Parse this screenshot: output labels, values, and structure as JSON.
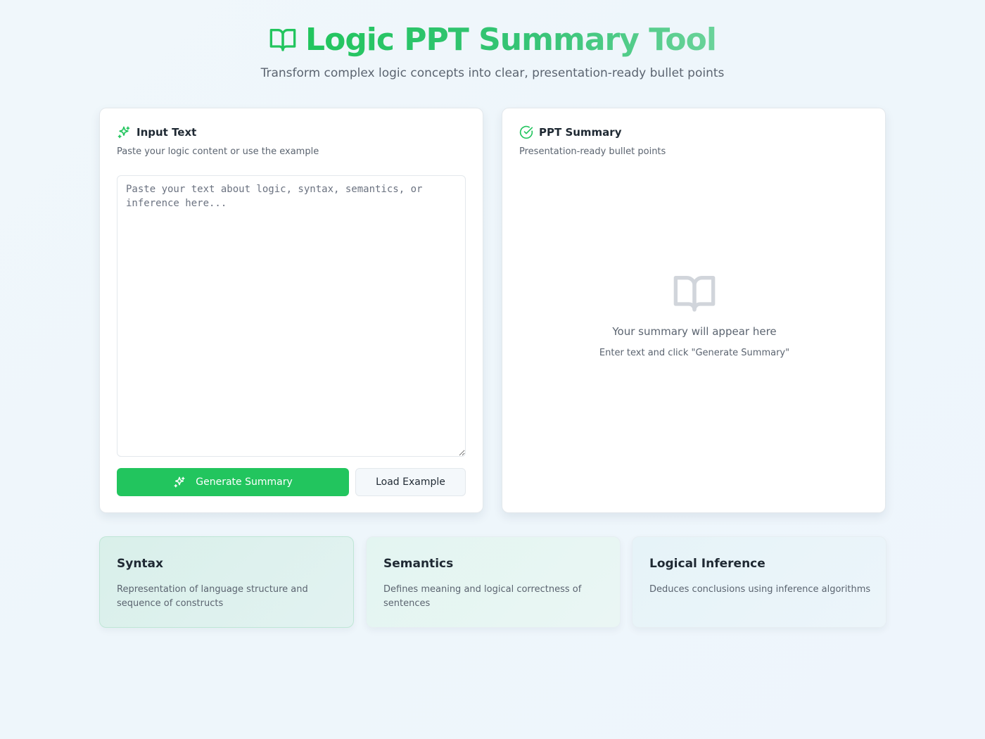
{
  "header": {
    "title": "Logic PPT Summary Tool",
    "subtitle": "Transform complex logic concepts into clear, presentation-ready bullet points",
    "icon": "book-open-icon"
  },
  "input_panel": {
    "icon": "sparkles-icon",
    "title": "Input Text",
    "description": "Paste your logic content or use the example",
    "textarea_value": "",
    "textarea_placeholder": "Paste your text about logic, syntax, semantics, or inference here...",
    "generate_label": "Generate Summary",
    "load_example_label": "Load Example"
  },
  "summary_panel": {
    "icon": "check-circle-icon",
    "title": "PPT Summary",
    "description": "Presentation-ready bullet points",
    "empty_icon": "book-open-icon",
    "empty_title": "Your summary will appear here",
    "empty_hint": "Enter text and click \"Generate Summary\""
  },
  "cards": [
    {
      "title": "Syntax",
      "description": "Representation of language structure and sequence of constructs"
    },
    {
      "title": "Semantics",
      "description": "Defines meaning and logical correctness of sentences"
    },
    {
      "title": "Logical Inference",
      "description": "Deduces conclusions using inference algorithms"
    }
  ],
  "colors": {
    "accent": "#22c55e",
    "text": "#1f2933",
    "muted": "#5b6470",
    "empty_icon": "#d1d5db"
  }
}
